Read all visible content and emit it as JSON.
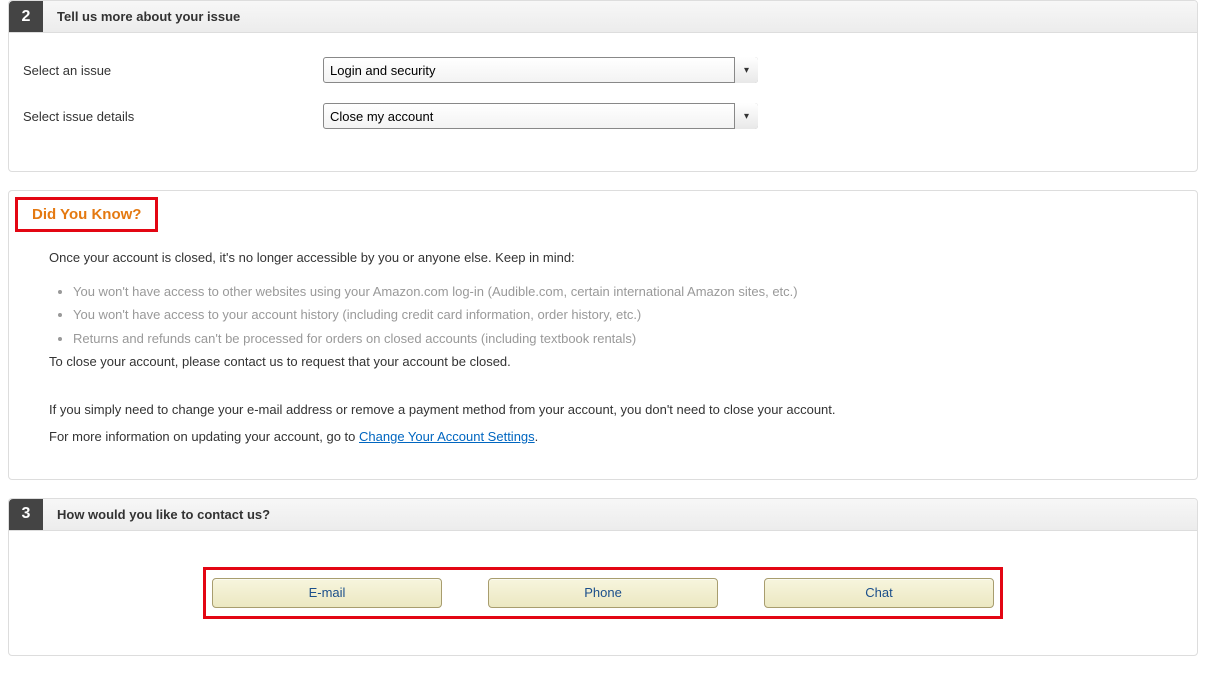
{
  "step2": {
    "number": "2",
    "title": "Tell us more about your issue",
    "rows": {
      "issue": {
        "label": "Select an issue",
        "value": "Login and security"
      },
      "details": {
        "label": "Select issue details",
        "value": "Close my account"
      }
    }
  },
  "didYouKnow": {
    "heading": "Did You Know?",
    "intro": "Once your account is closed, it's no longer accessible by you or anyone else. Keep in mind:",
    "bullets": [
      "You won't have access to other websites using your Amazon.com log-in (Audible.com, certain international Amazon sites, etc.)",
      "You won't have access to your account history (including credit card information, order history, etc.)",
      "Returns and refunds can't be processed for orders on closed accounts (including textbook rentals)"
    ],
    "closeLine": "To close your account, please contact us to request that your account be closed.",
    "changeLine": "If you simply need to change your e-mail address or remove a payment method from your account, you don't need to close your account.",
    "moreInfoPrefix": "For more information on updating your account, go to ",
    "moreInfoLink": "Change Your Account Settings",
    "moreInfoSuffix": "."
  },
  "step3": {
    "number": "3",
    "title": "How would you like to contact us?",
    "buttons": {
      "email": "E-mail",
      "phone": "Phone",
      "chat": "Chat"
    }
  }
}
